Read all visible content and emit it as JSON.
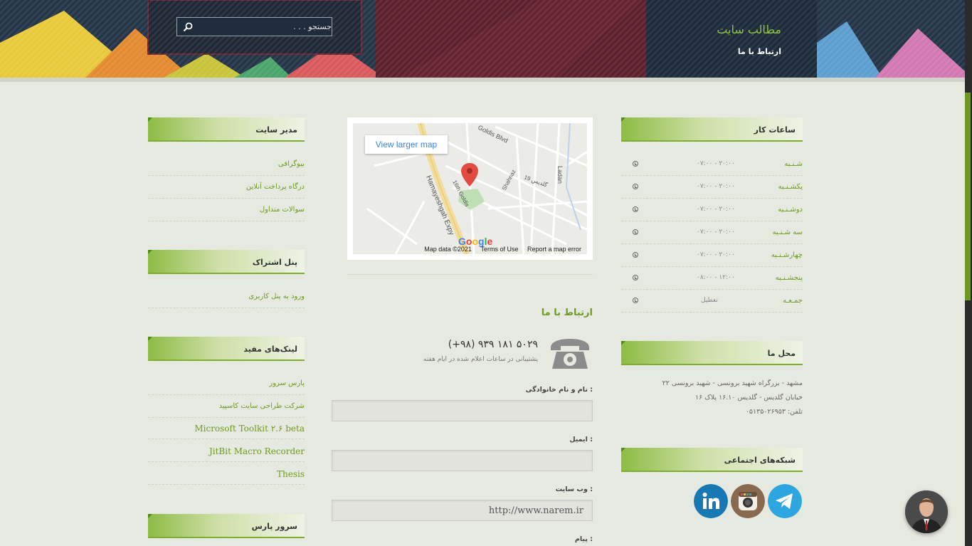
{
  "header": {
    "site_title": "مطالب سایت",
    "nav_contact": "ارتباط با ما",
    "search_placeholder": "جستجو . . ."
  },
  "left_sidebar": {
    "admin": {
      "title": "مدیر سایت",
      "links": [
        "بیوگرافی",
        "درگاه پرداخت آنلاین",
        "سوالات متداول"
      ]
    },
    "subscription": {
      "title": "پنل اشتراک",
      "links": [
        "ورود به پنل کاربری"
      ]
    },
    "useful_links": {
      "title": "لینک‌های مفید",
      "links": [
        "پارس سرور",
        "شرکت طراحی سایت کاسپید",
        "Microsoft Toolkit ۲.۶ beta",
        "JitBit Macro Recorder",
        "Thesis"
      ]
    },
    "pars_server": {
      "title": "سرور پارس"
    }
  },
  "map": {
    "view_larger": "View larger map",
    "map_data": "Map data ©2021",
    "terms": "Terms of Use",
    "report": "Report a map error",
    "google": "Google",
    "street_labels": [
      "Hamayeshgah Expy",
      "Goldis Blvd",
      "16th Goldis",
      "Ladan",
      "Shahnaz",
      "گلدیس 19"
    ]
  },
  "contact": {
    "title": "ارتباط با ما",
    "phone": "(+۹۸) ۹۳۹ ۱۸۱ ۵۰۲۹",
    "support_text": "پشتیبانی در ساعات اعلام شده در ایام هفته",
    "name_label": "نام و نام خانوادگی :",
    "email_label": "ایمیل :",
    "website_label": "وب سایت :",
    "website_value": "http://www.narem.ir",
    "message_label": "پیام :"
  },
  "hours": {
    "title": "ساعات کار",
    "rows": [
      {
        "day": "شـنـبه",
        "time": "۰۷:۰۰ - ۲۰:۰۰"
      },
      {
        "day": "یکشـنـبه",
        "time": "۰۷:۰۰ - ۲۰:۰۰"
      },
      {
        "day": "دوشـنـبه",
        "time": "۰۷:۰۰ - ۲۰:۰۰"
      },
      {
        "day": "سه شـنـبه",
        "time": "۰۷:۰۰ - ۲۰:۰۰"
      },
      {
        "day": "چهارشـنـبه",
        "time": "۰۷:۰۰ - ۲۰:۰۰"
      },
      {
        "day": "پنجشـنـبه",
        "time": "۰۸:۰۰ - ۱۲:۰۰"
      },
      {
        "day": "جمـعـه",
        "time": "تعطیل"
      }
    ]
  },
  "location": {
    "title": "محل ما",
    "line1": "مشهد - بزرگراه شهید برونسی - شهید برونسی ۲۲",
    "line2": "خیابان گلدیس - گلدیس ۱۶.۱۰ پلاک ۱۶",
    "line3": "تلفن: ۰۵۱۳۵۰۲۶۹۵۳"
  },
  "social": {
    "title": "شبکه‌های اجتماعی",
    "icons": [
      "telegram-icon",
      "instagram-icon",
      "linkedin-icon"
    ]
  },
  "colors": {
    "accent": "#6f9a23",
    "header_title": "#8dc63f",
    "header_bg": "#243447"
  }
}
